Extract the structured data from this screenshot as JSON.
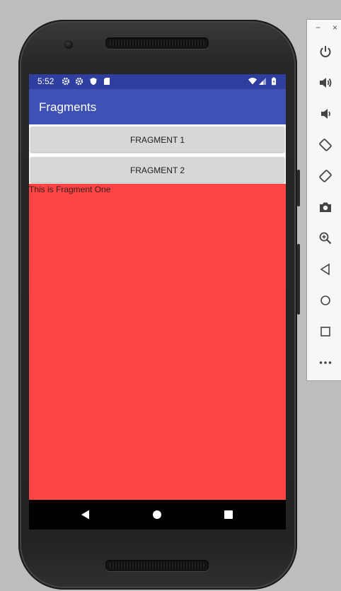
{
  "status_bar": {
    "time": "5:52",
    "left_icons": [
      "settings-icon",
      "settings-icon",
      "shield-icon",
      "sd-card-icon"
    ],
    "right_icons": [
      "wifi-icon",
      "cell-signal-icon",
      "battery-icon"
    ]
  },
  "app_bar": {
    "title": "Fragments"
  },
  "buttons": {
    "fragment1": "FRAGMENT 1",
    "fragment2": "FRAGMENT 2"
  },
  "fragment": {
    "text": "This is Fragment One",
    "background": "#ff4444"
  },
  "nav_bar": {
    "icons": [
      "back-icon",
      "home-icon",
      "recents-icon"
    ]
  },
  "emulator_toolbar": {
    "window_controls": {
      "minimize": "−",
      "close": "×"
    },
    "tools": [
      "power-icon",
      "volume-up-icon",
      "volume-down-icon",
      "rotate-left-icon",
      "rotate-right-icon",
      "camera-icon",
      "zoom-icon",
      "back-icon",
      "home-icon",
      "overview-icon",
      "more-icon"
    ]
  },
  "colors": {
    "status_bar": "#303f9f",
    "app_bar": "#3f51b5",
    "button": "#d6d7d7"
  }
}
